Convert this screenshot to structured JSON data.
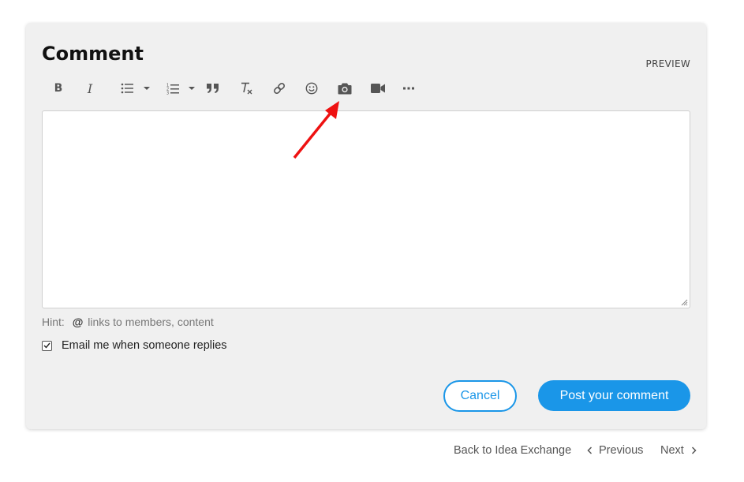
{
  "comment": {
    "title": "Comment",
    "preview_label": "PREVIEW",
    "toolbar": [
      {
        "name": "bold",
        "icon": "bold-icon",
        "glyph": "B"
      },
      {
        "name": "italic",
        "icon": "italic-icon",
        "glyph": "I"
      },
      {
        "name": "bulleted-list",
        "icon": "bulleted-list-icon"
      },
      {
        "name": "numbered-list",
        "icon": "numbered-list-icon"
      },
      {
        "name": "quote",
        "icon": "quote-icon"
      },
      {
        "name": "clear-formatting",
        "icon": "clear-formatting-icon"
      },
      {
        "name": "link",
        "icon": "link-icon"
      },
      {
        "name": "emoji",
        "icon": "emoji-icon"
      },
      {
        "name": "insert-photo",
        "icon": "camera-icon"
      },
      {
        "name": "insert-video",
        "icon": "video-camera-icon"
      },
      {
        "name": "more",
        "icon": "more-icon"
      }
    ],
    "editor_value": "",
    "hint_label": "Hint:",
    "hint_at": "@",
    "hint_text": "links to members, content",
    "email_checkbox_label": "Email me when someone replies",
    "email_checkbox_checked": true,
    "cancel_label": "Cancel",
    "post_label": "Post your comment"
  },
  "footer": {
    "back_label": "Back to Idea Exchange",
    "previous_label": "Previous",
    "next_label": "Next"
  },
  "colors": {
    "accent": "#1a96e8",
    "card_bg": "#f0f0f0",
    "annotation_arrow": "#ee1111"
  }
}
